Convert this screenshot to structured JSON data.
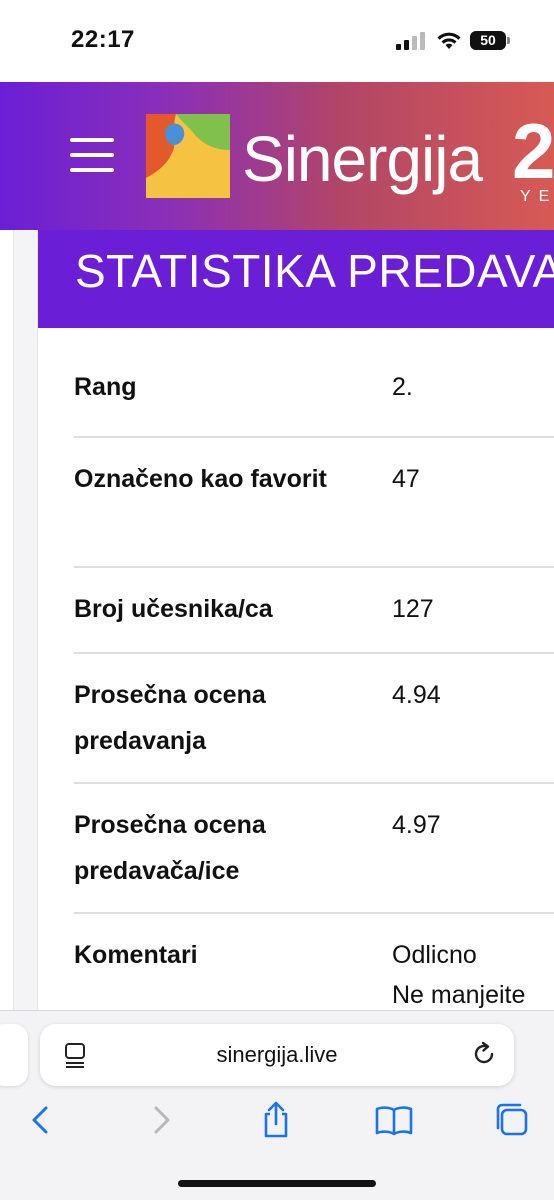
{
  "status_bar": {
    "time": "22:17",
    "battery_level": "50",
    "icons": [
      "cellular-signal-icon",
      "wifi-icon",
      "battery-icon"
    ]
  },
  "header": {
    "brand_name": "Sinergija",
    "brand_suffix": "2",
    "brand_sub": "YE",
    "icons": [
      "hamburger-menu-icon",
      "sinergija-logo-icon"
    ],
    "colors": {
      "gradient_start": "#6a1fd6",
      "gradient_end": "#d75a54"
    }
  },
  "card": {
    "title": "STATISTIKA PREDAVANJA",
    "accent_color": "#6a1fd6"
  },
  "stats": {
    "rows": [
      {
        "label": "Rang",
        "value": "2."
      },
      {
        "label": "Označeno kao favorit",
        "value": "47"
      },
      {
        "label": "Broj učesnika/ca",
        "value": "127"
      },
      {
        "label": "Prosečna ocena predavanja",
        "value": "4.94"
      },
      {
        "label": "Prosečna ocena predavača/ice",
        "value": "4.97"
      },
      {
        "label": "Komentari",
        "value": "Odlicno",
        "value_more": "Ne manjeite"
      }
    ]
  },
  "browser": {
    "url": "sinergija.live",
    "icons": [
      "reader-mode-icon",
      "reload-icon",
      "back-icon",
      "forward-icon",
      "share-icon",
      "bookmarks-icon",
      "tabs-icon"
    ],
    "accent_color": "#1a73e8"
  }
}
